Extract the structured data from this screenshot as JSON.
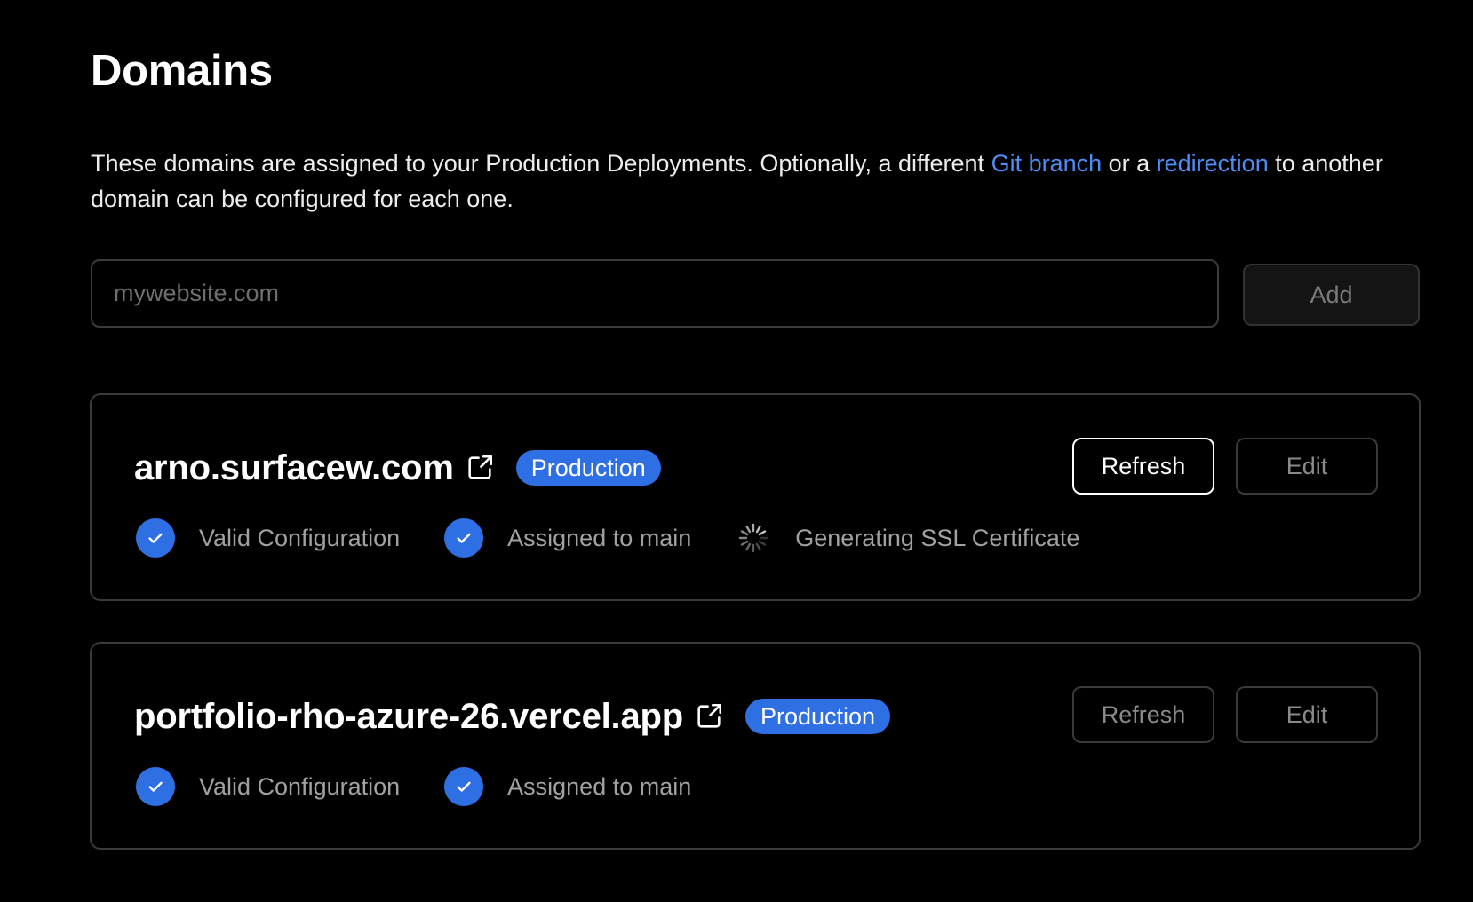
{
  "page": {
    "title": "Domains",
    "description": {
      "text_before": "These domains are assigned to your Production Deployments. Optionally, a different ",
      "link_git_branch": "Git branch",
      "text_middle": " or a ",
      "link_redirection": "redirection",
      "text_after": " to another domain can be configured for each one."
    }
  },
  "add_domain": {
    "input_value": "",
    "input_placeholder": "mywebsite.com",
    "button_label": "Add"
  },
  "colors": {
    "accent_blue": "#2f6fe4",
    "link_blue": "#4f8df5",
    "background": "#000000",
    "border": "#3b3b3b"
  },
  "domains": [
    {
      "name": "arno.surfacew.com",
      "external_link_icon": "external-link-icon",
      "badge": "Production",
      "refresh_label": "Refresh",
      "edit_label": "Edit",
      "statuses": [
        {
          "icon": "check-circle-icon",
          "label": "Valid Configuration"
        },
        {
          "icon": "check-circle-icon",
          "label": "Assigned to main"
        },
        {
          "icon": "spinner-icon",
          "label": "Generating SSL Certificate"
        }
      ]
    },
    {
      "name": "portfolio-rho-azure-26.vercel.app",
      "external_link_icon": "external-link-icon",
      "badge": "Production",
      "refresh_label": "Refresh",
      "edit_label": "Edit",
      "statuses": [
        {
          "icon": "check-circle-icon",
          "label": "Valid Configuration"
        },
        {
          "icon": "check-circle-icon",
          "label": "Assigned to main"
        }
      ]
    }
  ]
}
